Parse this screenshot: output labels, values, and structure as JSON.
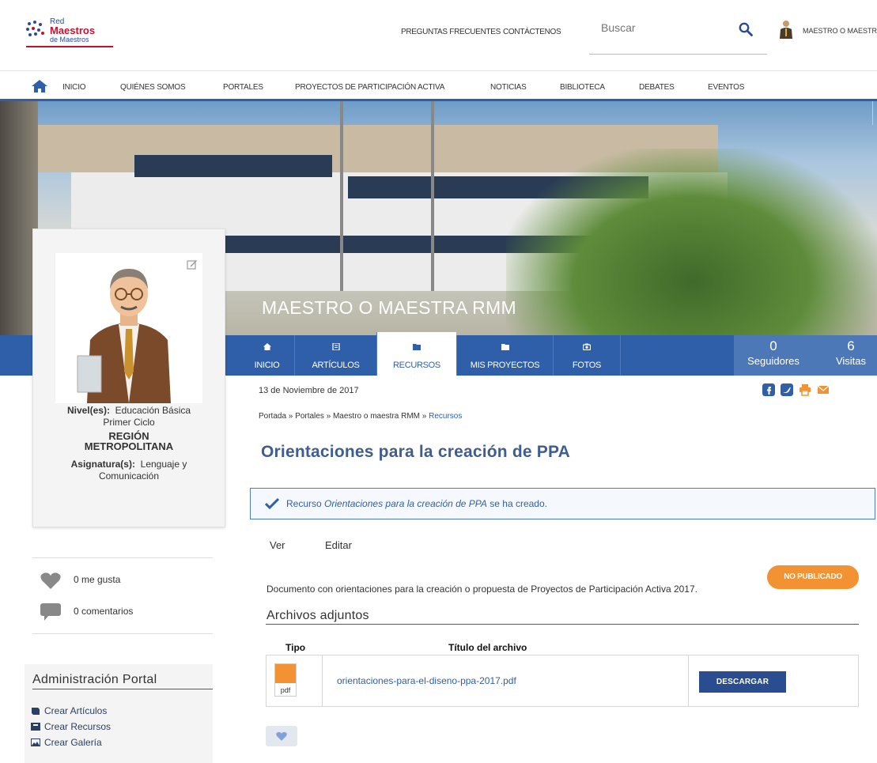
{
  "header": {
    "logo": {
      "line1": "Red",
      "line2": "Maestros",
      "line3": "de Maestros"
    },
    "faq": "PREGUNTAS FRECUENTES",
    "contact": "CONTÁCTENOS",
    "search_placeholder": "Buscar",
    "user": "MAESTRO O MAESTR"
  },
  "nav": {
    "items": [
      "INICIO",
      "QUIÉNES SOMOS",
      "PORTALES",
      "PROYECTOS DE PARTICIPACIÓN ACTIVA",
      "NOTICIAS",
      "BIBLIOTECA",
      "DEBATES",
      "EVENTOS"
    ]
  },
  "hero": {
    "title": "MAESTRO O MAESTRA RMM"
  },
  "tabs": [
    {
      "label": "INICIO",
      "icon": "home-icon"
    },
    {
      "label": "ARTÍCULOS",
      "icon": "article-icon"
    },
    {
      "label": "RECURSOS",
      "icon": "folder-icon"
    },
    {
      "label": "MIS PROYECTOS",
      "icon": "folder-icon"
    },
    {
      "label": "FOTOS",
      "icon": "camera-icon"
    }
  ],
  "stats": {
    "followers": {
      "value": "0",
      "label": "Seguidores"
    },
    "visits": {
      "value": "6",
      "label": "Visitas"
    }
  },
  "profile": {
    "level_label": "Nivel(es):",
    "level_value": "Educación Básica",
    "level_value2": "Primer Ciclo",
    "region1": "REGIÓN",
    "region2": "METROPOLITANA",
    "subject_label": "Asignatura(s):",
    "subject_value": "Lenguaje y",
    "subject_value2": "Comunicación"
  },
  "engagement": {
    "likes": "0 me gusta",
    "comments": "0 comentarios"
  },
  "admin": {
    "title": "Administración Portal",
    "items": [
      "Crear Artículos",
      "Crear Recursos",
      "Crear Galería"
    ]
  },
  "content": {
    "date": "13 de Noviembre de 2017",
    "breadcrumb": {
      "a": "Portada",
      "sep": " » ",
      "b": "Portales",
      "c": "Maestro o maestra RMM",
      "d": "Recursos"
    },
    "title": "Orientaciones para la creación de PPA",
    "alert": {
      "prefix": "Recurso ",
      "name": "Orientaciones para la creación de PPA",
      "suffix": " se ha creado."
    },
    "subtabs": {
      "view": "Ver",
      "edit": "Editar"
    },
    "description": "Documento con orientaciones para la creación o propuesta de Proyectos de Participación Activa 2017.",
    "badge": "NO PUBLICADO",
    "attachments_title": "Archivos adjuntos",
    "columns": {
      "type": "Tipo",
      "file": "Título del archivo"
    },
    "file": {
      "ext": "pdf",
      "name": "orientaciones-para-el-diseno-ppa-2017.pdf",
      "button": "DESCARGAR"
    }
  },
  "colors": {
    "primary": "#2f5fa8",
    "accent": "#f39233",
    "brand_red": "#c8102e"
  }
}
